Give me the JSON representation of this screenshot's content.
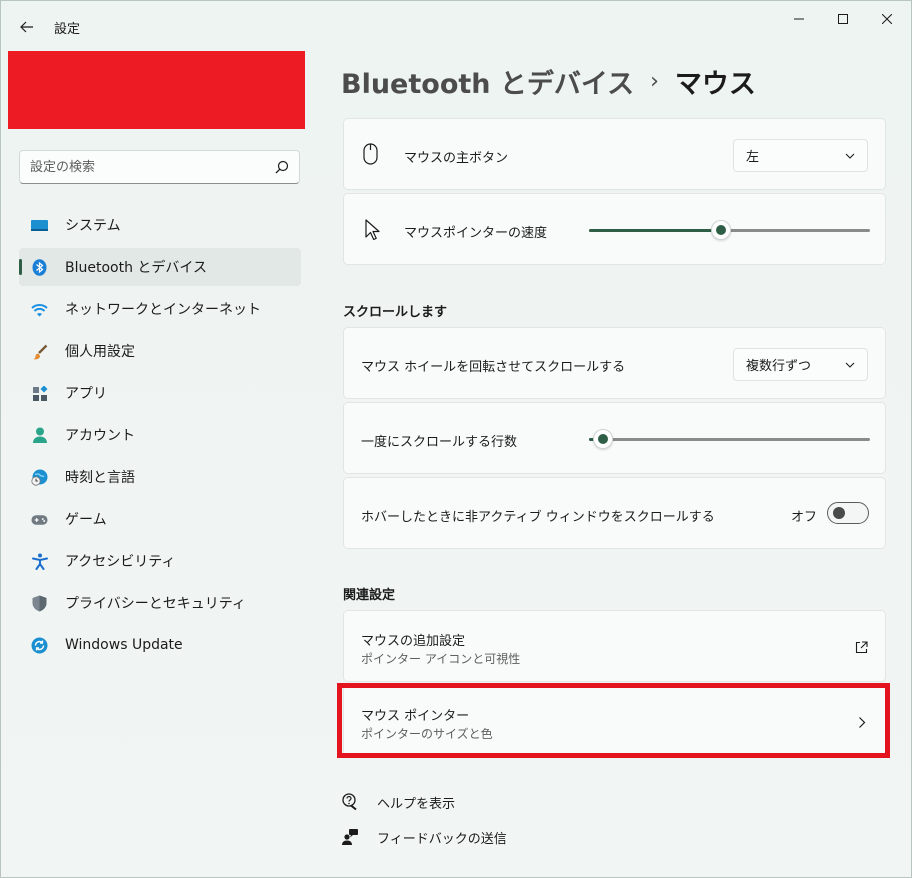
{
  "window": {
    "app_title": "設定",
    "controls": {
      "minimize": "minimize-icon",
      "maximize": "maximize-icon",
      "close": "close-icon"
    }
  },
  "search": {
    "placeholder": "設定の検索"
  },
  "sidebar": {
    "items": [
      {
        "label": "システム",
        "icon": "system-icon",
        "selected": false
      },
      {
        "label": "Bluetooth とデバイス",
        "icon": "bluetooth-icon",
        "selected": true
      },
      {
        "label": "ネットワークとインターネット",
        "icon": "wifi-icon",
        "selected": false
      },
      {
        "label": "個人用設定",
        "icon": "brush-icon",
        "selected": false
      },
      {
        "label": "アプリ",
        "icon": "apps-icon",
        "selected": false
      },
      {
        "label": "アカウント",
        "icon": "account-icon",
        "selected": false
      },
      {
        "label": "時刻と言語",
        "icon": "time-language-icon",
        "selected": false
      },
      {
        "label": "ゲーム",
        "icon": "gamepad-icon",
        "selected": false
      },
      {
        "label": "アクセシビリティ",
        "icon": "accessibility-icon",
        "selected": false
      },
      {
        "label": "プライバシーとセキュリティ",
        "icon": "shield-icon",
        "selected": false
      },
      {
        "label": "Windows Update",
        "icon": "windows-update-icon",
        "selected": false
      }
    ]
  },
  "breadcrumb": {
    "parent": "Bluetooth とデバイス",
    "separator": "›",
    "current": "マウス"
  },
  "settings": {
    "primary_button": {
      "label": "マウスの主ボタン",
      "value": "左"
    },
    "pointer_speed": {
      "label": "マウスポインターの速度",
      "level": 0.47
    },
    "scroll_section": "スクロールします",
    "wheel_scroll": {
      "label": "マウス ホイールを回転させてスクロールする",
      "value": "複数行ずつ"
    },
    "lines_per_scroll": {
      "label": "一度にスクロールする行数",
      "level": 0.05
    },
    "inactive_scroll": {
      "label": "ホバーしたときに非アクティブ ウィンドウをスクロールする",
      "state": "オフ"
    },
    "related_section": "関連設定",
    "additional": {
      "title": "マウスの追加設定",
      "subtitle": "ポインター アイコンと可視性"
    },
    "pointer": {
      "title": "マウス ポインター",
      "subtitle": "ポインターのサイズと色"
    }
  },
  "footer": {
    "help": "ヘルプを表示",
    "feedback": "フィードバックの送信"
  },
  "colors": {
    "accent": "#2f5e47",
    "highlight": "#e3141d",
    "redaction": "#ed1c24"
  }
}
